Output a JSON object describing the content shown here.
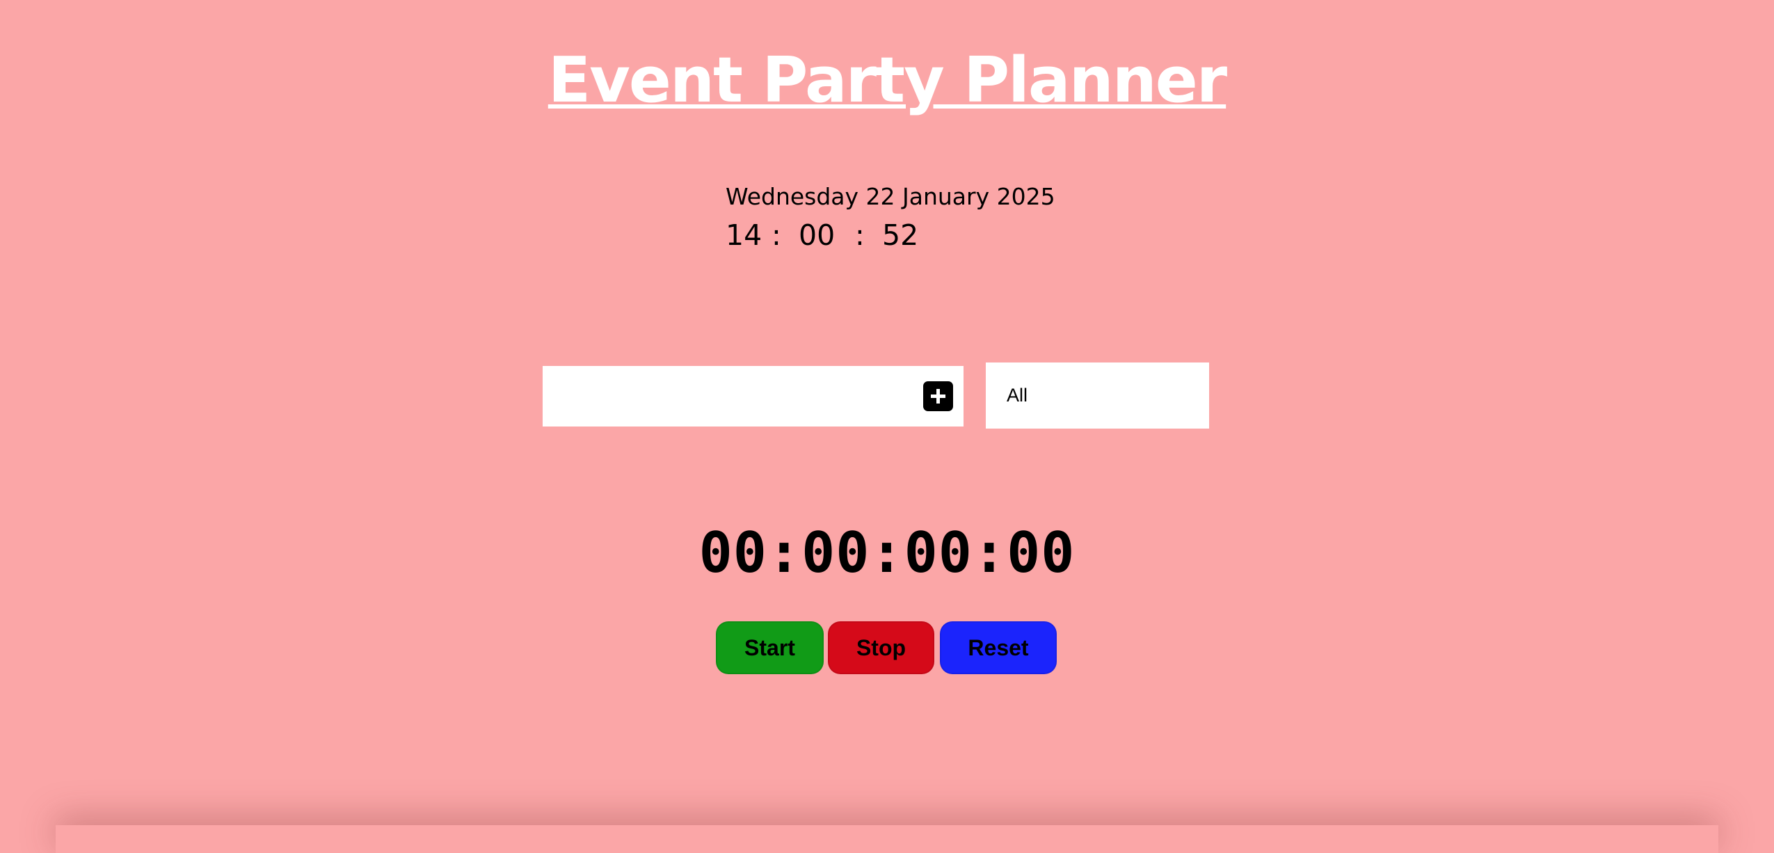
{
  "app": {
    "title": "Event Party Planner"
  },
  "clock": {
    "date": "Wednesday 22 January 2025",
    "hours": "14",
    "minutes": "00",
    "seconds": "52",
    "separator": ":"
  },
  "todo": {
    "input_value": "",
    "input_placeholder": "",
    "add_icon": "plus-icon",
    "filter_selected": "All"
  },
  "stopwatch": {
    "display": "00:00:00:00",
    "start_label": "Start",
    "stop_label": "Stop",
    "reset_label": "Reset"
  },
  "colors": {
    "background": "#fba6a7",
    "title": "#ffffff",
    "start": "#119b17",
    "stop": "#d50a19",
    "reset": "#1b24fc"
  }
}
